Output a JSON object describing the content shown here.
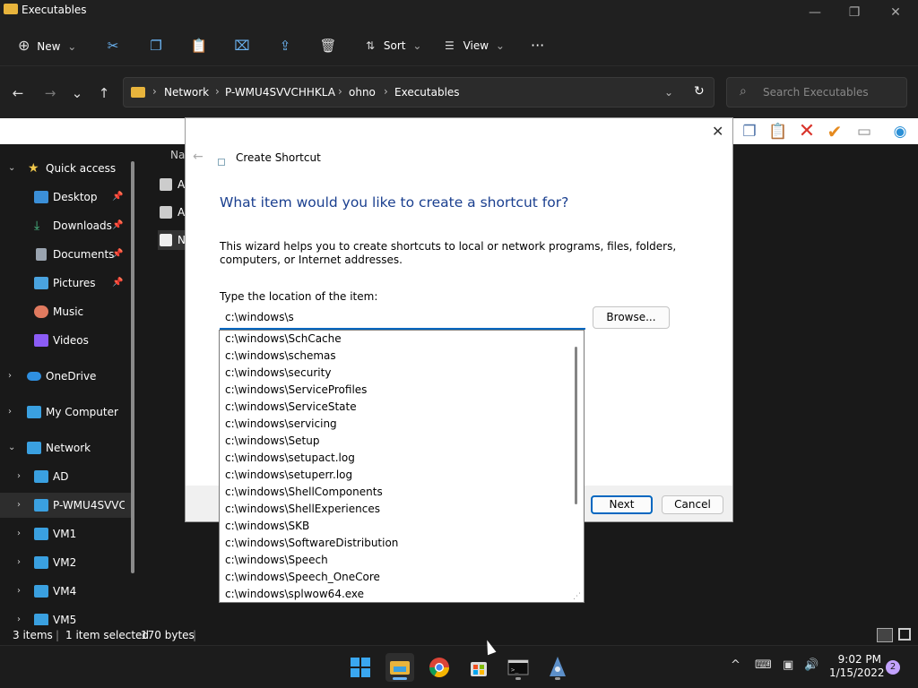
{
  "window": {
    "title": "Executables",
    "minimize": "—",
    "maximize": "❐",
    "close": "✕"
  },
  "commandbar": {
    "new_label": "New",
    "sort_label": "Sort",
    "view_label": "View",
    "more": "···",
    "chevron": "⌄"
  },
  "nav": {
    "back": "←",
    "forward": "→",
    "recent": "⌄",
    "up": "↑"
  },
  "address": {
    "crumbs": [
      "Network",
      "P-WMU4SVVCHHKLA",
      "ohno",
      "Executables"
    ],
    "separator": "›",
    "dropdown": "⌄",
    "refresh": "↻"
  },
  "search": {
    "placeholder": "Search Executables",
    "icon": "⌕"
  },
  "sidebar": {
    "items": [
      {
        "label": "Quick access",
        "chevron": "⌄",
        "pinned": false
      },
      {
        "label": "Desktop",
        "pin": "📌"
      },
      {
        "label": "Downloads",
        "pin": "📌"
      },
      {
        "label": "Documents",
        "pin": "📌"
      },
      {
        "label": "Pictures",
        "pin": "📌"
      },
      {
        "label": "Music"
      },
      {
        "label": "Videos"
      },
      {
        "label": "OneDrive",
        "chevron": "›"
      },
      {
        "label": "My Computer",
        "chevron": "›"
      },
      {
        "label": "Network",
        "chevron": "⌄"
      },
      {
        "label": "AD",
        "chevron": "›"
      },
      {
        "label": "P-WMU4SVVCHHKLA",
        "chevron": "›"
      },
      {
        "label": "VM1",
        "chevron": "›"
      },
      {
        "label": "VM2",
        "chevron": "›"
      },
      {
        "label": "VM4",
        "chevron": "›"
      },
      {
        "label": "VM5",
        "chevron": "›"
      }
    ]
  },
  "filelist": {
    "column_name": "Na",
    "rows": [
      "A",
      "A",
      "N"
    ]
  },
  "status": {
    "items": "3 items",
    "selected": "1 item selected",
    "size": "170 bytes"
  },
  "dialog": {
    "close": "✕",
    "back": "←",
    "title": "Create Shortcut",
    "heading": "What item would you like to create a shortcut for?",
    "description": "This wizard helps you to create shortcuts to local or network programs, files, folders, computers, or Internet addresses.",
    "location_label": "Type the location of the item:",
    "location_value": "c:\\windows\\s",
    "browse_label": "Browse...",
    "next_label": "Next",
    "cancel_label": "Cancel"
  },
  "autocomplete": {
    "items": [
      "c:\\windows\\SchCache",
      "c:\\windows\\schemas",
      "c:\\windows\\security",
      "c:\\windows\\ServiceProfiles",
      "c:\\windows\\ServiceState",
      "c:\\windows\\servicing",
      "c:\\windows\\Setup",
      "c:\\windows\\setupact.log",
      "c:\\windows\\setuperr.log",
      "c:\\windows\\ShellComponents",
      "c:\\windows\\ShellExperiences",
      "c:\\windows\\SKB",
      "c:\\windows\\SoftwareDistribution",
      "c:\\windows\\Speech",
      "c:\\windows\\Speech_OneCore",
      "c:\\windows\\splwow64.exe"
    ]
  },
  "taskbar": {
    "time": "9:02 PM",
    "date": "1/15/2022",
    "notifications": "2",
    "tray_chevron": "^"
  },
  "colors": {
    "accent": "#0067c0",
    "heading": "#1a3f8f",
    "folder": "#e8b43c"
  }
}
